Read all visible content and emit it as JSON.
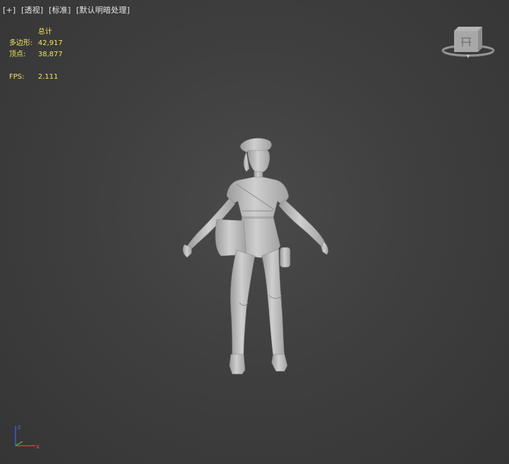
{
  "viewport": {
    "labels": [
      "[+]",
      "[透视]",
      "[标准]",
      "[默认明暗处理]"
    ]
  },
  "stats": {
    "header": "总计",
    "polygons_label": "多边形:",
    "polygons_value": "42,917",
    "vertices_label": "顶点:",
    "vertices_value": "38,877",
    "fps_label": "FPS:",
    "fps_value": "2.111"
  },
  "axis": {
    "z": "z",
    "x": "x"
  },
  "colors": {
    "stats_text": "#f1e35a",
    "label_text": "#e6e6e6",
    "background": "#3f3f3f",
    "model": "#c8c8c8"
  },
  "icons": [
    "viewcube-icon",
    "axis-gizmo-icon"
  ]
}
